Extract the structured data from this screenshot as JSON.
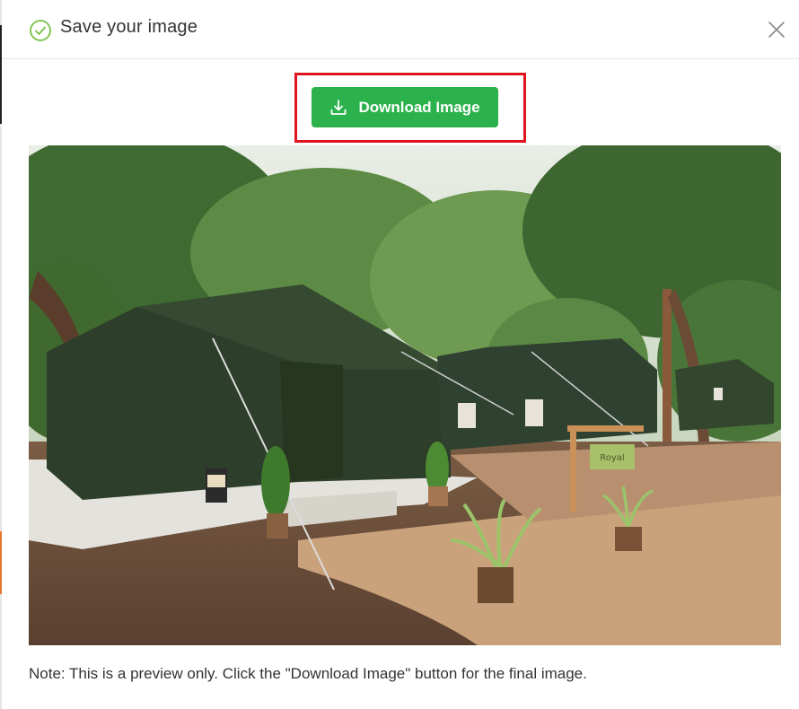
{
  "dialog": {
    "title": "Save your image",
    "download_label": "Download Image",
    "note": "Note: This is a preview only. Click the \"Download Image\" button for the final image."
  },
  "icons": {
    "title_icon": "check-circle-icon",
    "close_icon": "close-icon",
    "download_icon": "download-icon"
  },
  "colors": {
    "accent_green": "#2bb24c",
    "check_green": "#7ac143",
    "highlight_red": "#e0141e"
  },
  "preview": {
    "sign_text": "Royal"
  }
}
